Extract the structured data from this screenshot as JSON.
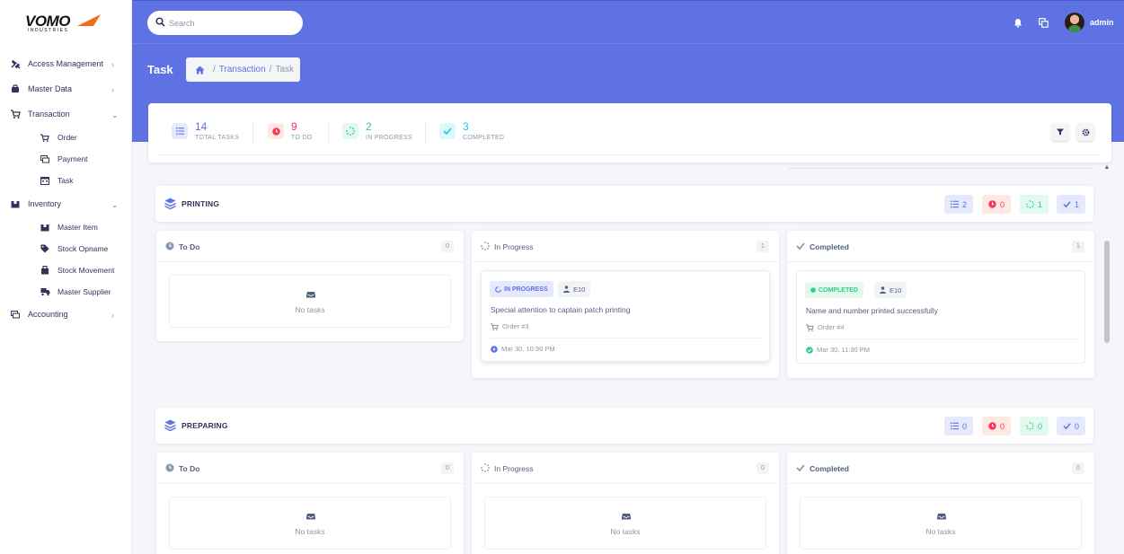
{
  "brand": {
    "logo": "VOMO",
    "sub": "INDUSTRIES"
  },
  "sidebar": {
    "items": [
      {
        "label": "Access Management",
        "icon": "tools-icon"
      },
      {
        "label": "Master Data",
        "icon": "database-icon"
      },
      {
        "label": "Transaction",
        "icon": "cart-icon"
      },
      {
        "label": "Inventory",
        "icon": "box-icon"
      },
      {
        "label": "Accounting",
        "icon": "money-icon"
      }
    ],
    "transaction_sub": [
      {
        "label": "Order"
      },
      {
        "label": "Payment"
      },
      {
        "label": "Task"
      }
    ],
    "inventory_sub": [
      {
        "label": "Master Item"
      },
      {
        "label": "Stock Opname"
      },
      {
        "label": "Stock Movement"
      },
      {
        "label": "Master Supplier"
      }
    ]
  },
  "header": {
    "search_placeholder": "Search",
    "user": "admin",
    "page_title": "Task",
    "breadcrumb": {
      "link": "Transaction",
      "sep": "/",
      "current": "Task"
    }
  },
  "summary": {
    "total": {
      "value": "14",
      "label": "TOTAL TASKS"
    },
    "todo": {
      "value": "9",
      "label": "TO DO"
    },
    "progress": {
      "value": "2",
      "label": "IN PROGRESS"
    },
    "completed": {
      "value": "3",
      "label": "COMPLETED"
    }
  },
  "sections": [
    {
      "title": "PRINTING",
      "pills": {
        "total": "2",
        "todo": "0",
        "progress": "1",
        "done": "1"
      },
      "todo": {
        "title": "To Do",
        "count": "0",
        "empty": "No tasks"
      },
      "progress": {
        "title": "In Progress",
        "count": "1",
        "task": {
          "badge": "IN PROGRESS",
          "user": "E10",
          "desc": "Special attention to captain patch printing",
          "order": "Order #3",
          "time": "Mar 30, 10:30 PM"
        }
      },
      "completed": {
        "title": "Completed",
        "count": "1",
        "task": {
          "badge": "COMPLETED",
          "user": "E10",
          "desc": "Name and number printed successfully",
          "order": "Order #4",
          "time": "Mar 30, 11:30 PM"
        }
      }
    },
    {
      "title": "PREPARING",
      "pills": {
        "total": "0",
        "todo": "0",
        "progress": "0",
        "done": "0"
      },
      "todo": {
        "title": "To Do",
        "count": "0",
        "empty": "No tasks"
      },
      "progress": {
        "title": "In Progress",
        "count": "0",
        "empty": "No tasks"
      },
      "completed": {
        "title": "Completed",
        "count": "0",
        "empty": "No tasks"
      }
    }
  ],
  "colors": {
    "primary": "#5e72e4",
    "danger": "#f5365c",
    "success": "#2dce89",
    "info": "#11cdef"
  }
}
